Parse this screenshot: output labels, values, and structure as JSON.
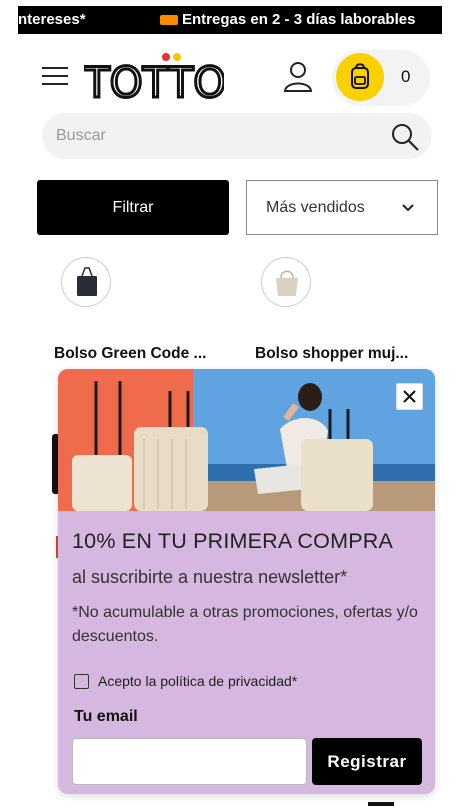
{
  "topbar": {
    "left_text": "ntereses*",
    "right_text": "Entregas en 2 - 3 días laborables",
    "truck_icon": "truck-icon"
  },
  "header": {
    "menu_icon": "hamburger-menu-icon",
    "brand": "TOTTO",
    "user_icon": "user-icon",
    "cart_icon": "backpack-icon",
    "cart_count": "0",
    "colors": {
      "cart_bg": "#f9d000",
      "logo_dot_red": "#e63232",
      "logo_dot_yellow": "#f7c600"
    }
  },
  "search": {
    "placeholder": "Buscar",
    "icon": "search-icon"
  },
  "filters": {
    "filter_label": "Filtrar",
    "sort_selected": "Más vendidos",
    "sort_icon": "chevron-down-icon"
  },
  "products": [
    {
      "title": "Bolso Green Code ...",
      "swatch": "black-tote-swatch",
      "swatch_color": "#2a2d33"
    },
    {
      "title": "Bolso shopper muj...",
      "swatch": "beige-tote-swatch",
      "swatch_color": "#d8d1c3"
    }
  ],
  "popup": {
    "close_icon": "close-icon",
    "image": "luggage-beach-photo",
    "title": "10% EN TU PRIMERA COMPRA",
    "subtitle": "al suscribirte a nuestra newsletter*",
    "note": "*No acumulable a otras promociones, ofertas y/o descuentos.",
    "checkbox_label": "Acepto la política de privacidad*",
    "email_label": "Tu email",
    "email_value": "",
    "submit_label": "Registrar",
    "colors": {
      "background": "#d6b7df",
      "button": "#000000"
    }
  }
}
